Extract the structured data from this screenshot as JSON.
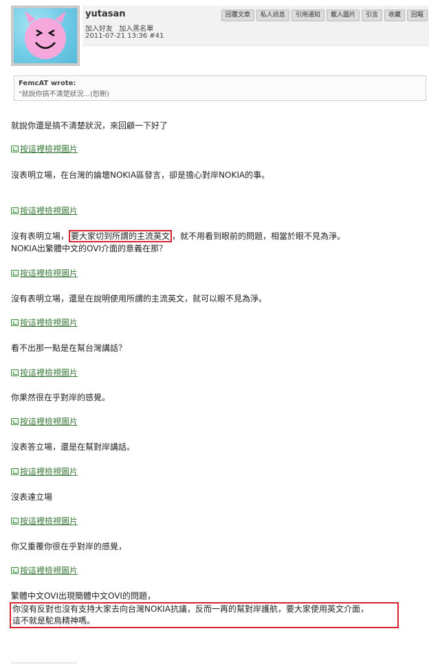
{
  "post": {
    "username": "yutasan",
    "links": [
      "加入好友",
      "加入黑名單"
    ],
    "date": "2011-07-21 13:36 #41",
    "actions": [
      "回覆文章",
      "私人訊息",
      "引用通知",
      "載入圖片",
      "引言",
      "收藏",
      "回報"
    ]
  },
  "quote": {
    "author": "FemcAT wrote:",
    "text": "\"就說你搞不清楚狀況...(恕刪)"
  },
  "image_link_label": "按這裡檢視圖片",
  "body": {
    "p1": "就說你還是搞不清楚狀況，來回顧一下好了",
    "p2": "沒表明立場，在台灣的論壇NOKIA區發言，卻是擔心對岸NOKIA的事。",
    "p3a": "沒有表明立場，",
    "p3b": "要大家切到所謂的主流英文",
    "p3c": "，就不用看到眼前的問題，相當於眼不見為淨。",
    "p3d": "NOKIA出繁體中文的OVI介面的意義在那？",
    "p4": "沒有表明立場，還是在說明使用所謂的主流英文，就可以眼不見為淨。",
    "p5": "看不出那一點是在幫台灣講話？",
    "p6": "你果然很在乎對岸的感覺。",
    "p7": "沒表答立場，還是在幫對岸講話。",
    "p8": "沒表達立場",
    "p9": "你又重覆你很在乎對岸的感覺，",
    "p10": "繁體中文OVI出現簡體中文OVI的問題，",
    "p11": "你沒有反對也沒有支持大家去向台灣NOKIA抗議，反而一再的幫對岸護航，要大家使用英文介面，",
    "p12": "這不就是駝鳥精神嗎。"
  },
  "colors": {
    "highlight": "#d6202a",
    "link": "#3a7a3a"
  }
}
